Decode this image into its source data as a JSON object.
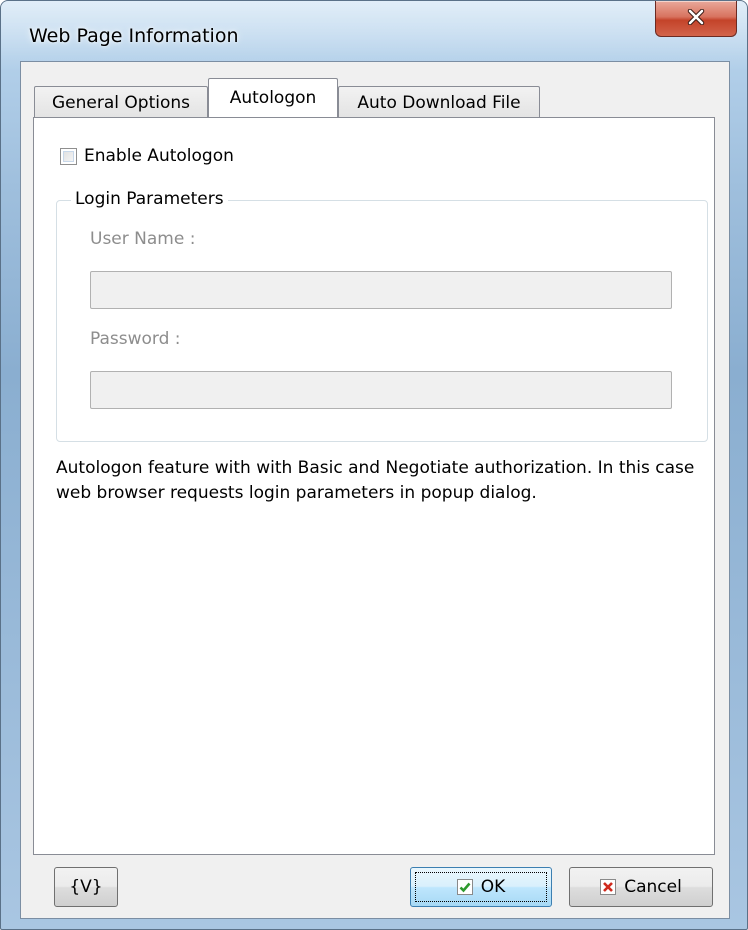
{
  "window": {
    "title": "Web Page Information",
    "close_label": "X"
  },
  "tabs": [
    {
      "label": "General Options",
      "active": false
    },
    {
      "label": "Autologon",
      "active": true
    },
    {
      "label": "Auto Download File",
      "active": false
    }
  ],
  "autologon": {
    "enable_label": "Enable Autologon",
    "enable_checked": false,
    "group_title": "Login Parameters",
    "user_name_label": "User Name :",
    "user_name_value": "",
    "password_label": "Password :",
    "password_value": "",
    "description": "Autologon feature with with Basic and Negotiate authorization. In this case web browser requests login parameters in popup dialog."
  },
  "buttons": {
    "variables_label": "{V}",
    "ok_label": "OK",
    "cancel_label": "Cancel"
  },
  "icons": {
    "close": "close-icon",
    "ok": "checkmark-icon",
    "cancel": "x-icon"
  },
  "colors": {
    "ok_icon": "#2e9a2e",
    "cancel_icon": "#d02a1e",
    "close_button": "#c4432a"
  }
}
